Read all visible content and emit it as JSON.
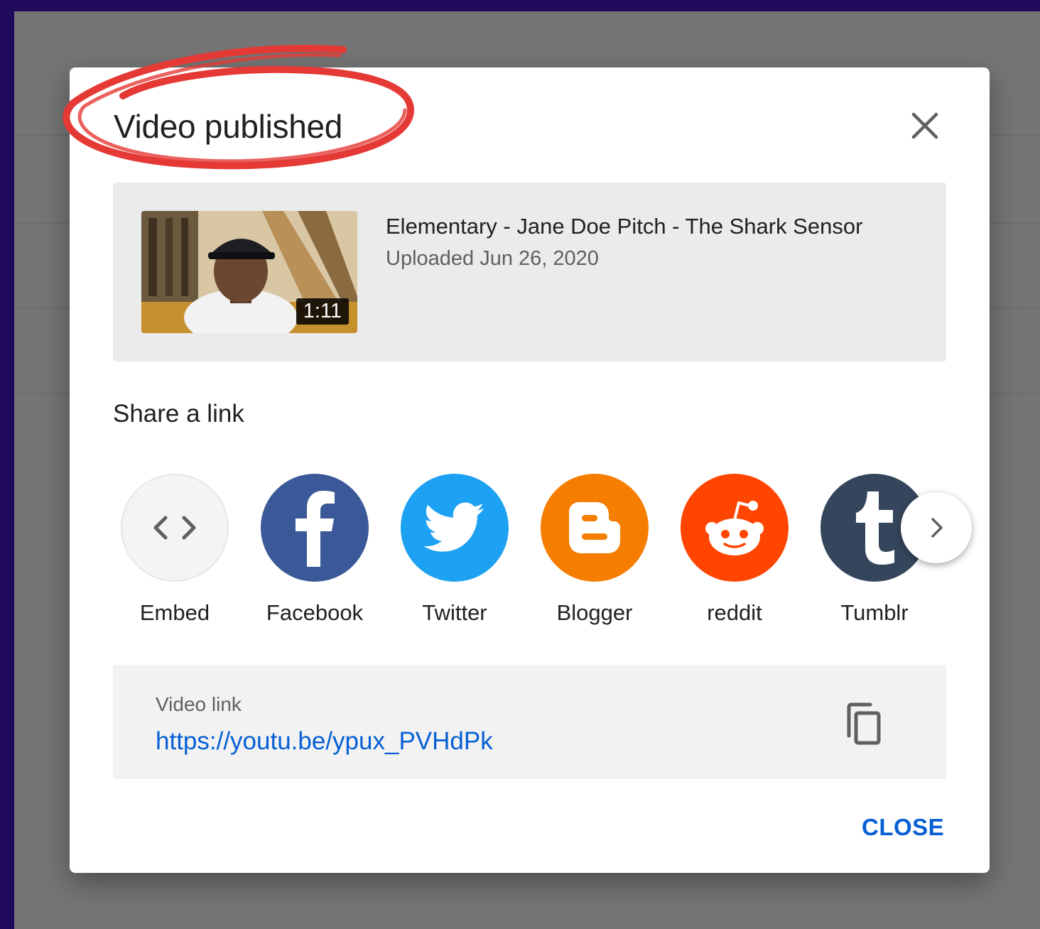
{
  "dialog": {
    "title": "Video published",
    "close_icon": "close-icon",
    "close_button_label": "CLOSE"
  },
  "video": {
    "title": "Elementary - Jane Doe Pitch - The Shark Sensor",
    "uploaded": "Uploaded Jun 26, 2020",
    "duration": "1:11"
  },
  "share": {
    "heading": "Share a link",
    "items": [
      {
        "label": "Embed",
        "icon": "embed-code-icon",
        "color": "#f4f4f4"
      },
      {
        "label": "Facebook",
        "icon": "facebook-icon",
        "color": "#3b5998"
      },
      {
        "label": "Twitter",
        "icon": "twitter-icon",
        "color": "#1da1f2"
      },
      {
        "label": "Blogger",
        "icon": "blogger-icon",
        "color": "#f57d00"
      },
      {
        "label": "reddit",
        "icon": "reddit-icon",
        "color": "#ff4500"
      },
      {
        "label": "Tumblr",
        "icon": "tumblr-icon",
        "color": "#35465c"
      }
    ],
    "next_icon": "chevron-right-icon"
  },
  "link": {
    "label": "Video link",
    "url": "https://youtu.be/ypux_PVHdPk",
    "copy_icon": "copy-icon"
  },
  "colors": {
    "accent": "#065fd4",
    "annotation": "#e53935",
    "frame": "#1f0a5e",
    "overlay": "#757575"
  }
}
